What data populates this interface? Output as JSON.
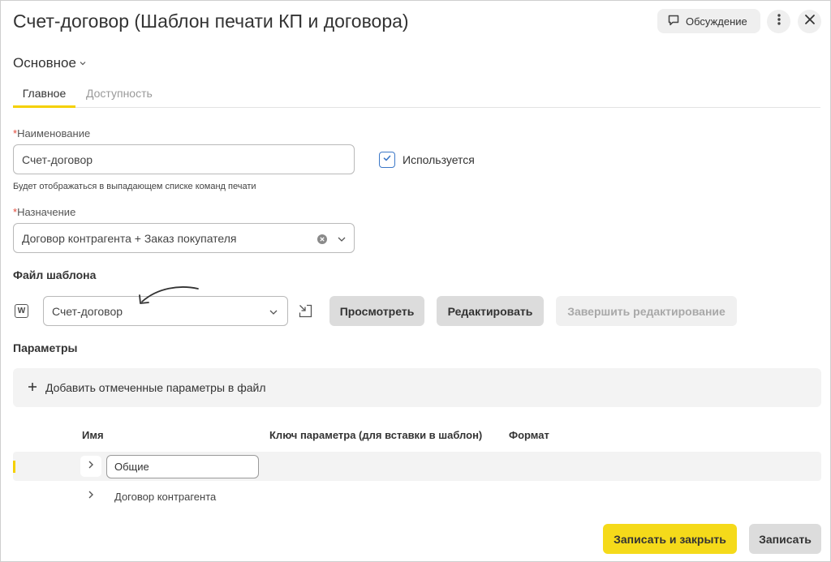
{
  "window": {
    "title": "Счет-договор (Шаблон печати КП и договора)"
  },
  "header": {
    "discussion_label": "Обсуждение"
  },
  "section": {
    "title": "Основное"
  },
  "tabs": [
    {
      "label": "Главное",
      "active": true
    },
    {
      "label": "Доступность",
      "active": false
    }
  ],
  "form": {
    "name_label": "Наименование",
    "name_value": "Счет-договор",
    "name_hint": "Будет отображаться в выпадающем списке команд печати",
    "used_label": "Используется",
    "used_checked": true,
    "purpose_label": "Назначение",
    "purpose_value": "Договор контрагента + Заказ покупателя",
    "required_mark": "*"
  },
  "template_file": {
    "label": "Файл шаблона",
    "file_type_glyph": "W",
    "value": "Счет-договор",
    "preview_label": "Просмотреть",
    "edit_label": "Редактировать",
    "finish_edit_label": "Завершить редактирование"
  },
  "params": {
    "label": "Параметры",
    "add_label": "Добавить отмеченные параметры в файл",
    "columns": [
      "Имя",
      "Ключ параметра (для вставки в шаблон)",
      "Формат"
    ],
    "rows": [
      {
        "name": "Общие",
        "selected": true
      },
      {
        "name": "Договор контрагента",
        "selected": false
      }
    ]
  },
  "footer": {
    "save_close_label": "Записать и закрыть",
    "save_label": "Записать"
  },
  "colors": {
    "accent": "#f5da1a",
    "tab_underline": "#f5d000",
    "checkbox": "#3c78c8",
    "required": "#e24a3b"
  }
}
